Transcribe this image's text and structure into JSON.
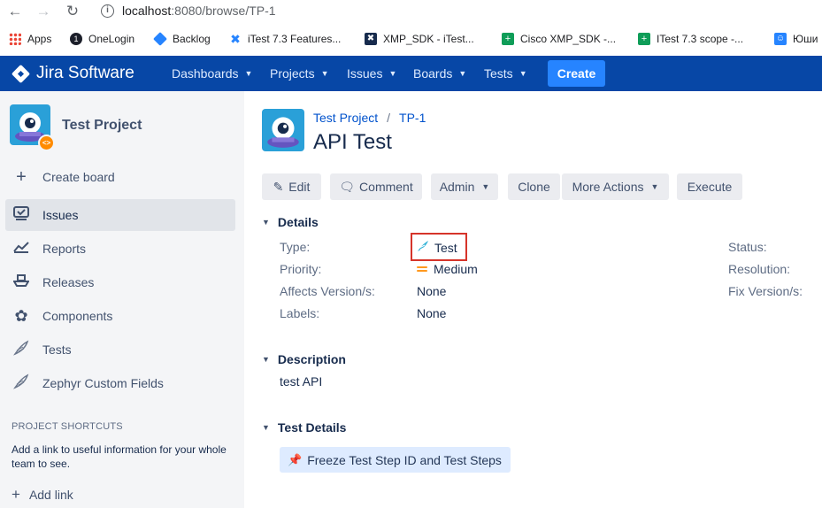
{
  "browser": {
    "url_host": "localhost",
    "url_rest": ":8080/browse/TP-1",
    "bookmarks": [
      {
        "label": "Apps",
        "color": "#ea4335"
      },
      {
        "label": "OneLogin",
        "color": "#1c1f2a"
      },
      {
        "label": "Backlog",
        "color": "#2684ff"
      },
      {
        "label": "iTest 7.3 Features...",
        "color": "#2684ff"
      },
      {
        "label": "XMP_SDK - iTest...",
        "color": "#172b4d"
      },
      {
        "label": "Cisco XMP_SDK -...",
        "color": "#0f9d58"
      },
      {
        "label": "ITest 7.3 scope -...",
        "color": "#0f9d58"
      },
      {
        "label": "Юши",
        "color": "#2684ff"
      }
    ]
  },
  "topnav": {
    "logo": "Jira Software",
    "items": [
      "Dashboards",
      "Projects",
      "Issues",
      "Boards",
      "Tests"
    ],
    "create": "Create"
  },
  "sidebar": {
    "project_name": "Test Project",
    "items": [
      {
        "label": "Create board",
        "icon": "plus-icon"
      },
      {
        "label": "Issues",
        "icon": "issues-icon"
      },
      {
        "label": "Reports",
        "icon": "chart-icon"
      },
      {
        "label": "Releases",
        "icon": "ship-icon"
      },
      {
        "label": "Components",
        "icon": "puzzle-icon"
      },
      {
        "label": "Tests",
        "icon": "feather-icon"
      },
      {
        "label": "Zephyr Custom Fields",
        "icon": "feather-icon"
      }
    ],
    "shortcuts_heading": "PROJECT SHORTCUTS",
    "shortcuts_text": "Add a link to useful information for your whole team to see.",
    "add_link": "Add link"
  },
  "issue": {
    "breadcrumb_project": "Test Project",
    "breadcrumb_sep": "/",
    "breadcrumb_key": "TP-1",
    "title": "API Test",
    "actions": {
      "edit": "Edit",
      "comment": "Comment",
      "admin": "Admin",
      "clone": "Clone",
      "more": "More Actions",
      "execute": "Execute"
    },
    "details_heading": "Details",
    "fields": {
      "type_label": "Type:",
      "type_value": "Test",
      "priority_label": "Priority:",
      "priority_value": "Medium",
      "affects_label": "Affects Version/s:",
      "affects_value": "None",
      "labels_label": "Labels:",
      "labels_value": "None",
      "status_label": "Status:",
      "resolution_label": "Resolution:",
      "fix_label": "Fix Version/s:"
    },
    "description_heading": "Description",
    "description": "test API",
    "test_details_heading": "Test Details",
    "freeze_button": "Freeze Test Step ID and Test Steps"
  }
}
